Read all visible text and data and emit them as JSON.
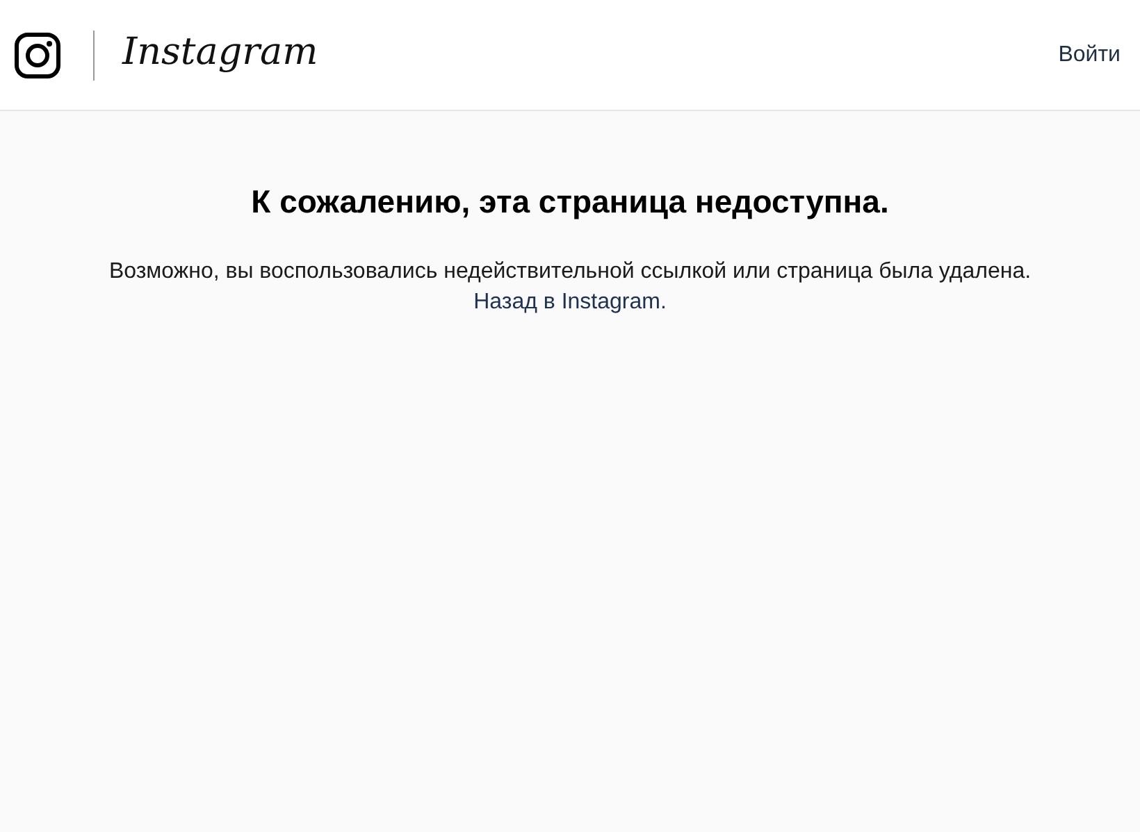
{
  "header": {
    "logo_text": "Instagram",
    "login_link": "Войти"
  },
  "error": {
    "title": "К сожалению, эта страница недоступна.",
    "message": "Возможно, вы воспользовались недействительной ссылкой или страница была удалена.",
    "back_link": "Назад в Instagram."
  }
}
